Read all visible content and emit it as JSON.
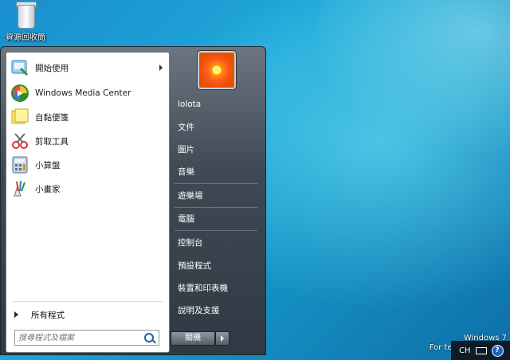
{
  "desktop": {
    "recycle_bin_label": "資源回收筒"
  },
  "start_menu": {
    "programs": [
      {
        "label": "開始使用",
        "icon": "getting-started-icon",
        "has_submenu": true
      },
      {
        "label": "Windows Media Center",
        "icon": "media-center-icon",
        "has_submenu": false
      },
      {
        "label": "自黏便箋",
        "icon": "sticky-notes-icon",
        "has_submenu": false
      },
      {
        "label": "剪取工具",
        "icon": "snipping-tool-icon",
        "has_submenu": false
      },
      {
        "label": "小算盤",
        "icon": "calculator-icon",
        "has_submenu": false
      },
      {
        "label": "小畫家",
        "icon": "paint-icon",
        "has_submenu": false
      }
    ],
    "all_programs_label": "所有程式",
    "search": {
      "placeholder": "搜尋程式及檔案",
      "value": ""
    },
    "user": {
      "name": "lolota",
      "avatar_icon": "flower-avatar-icon"
    },
    "right_items": [
      {
        "label": "文件"
      },
      {
        "label": "圖片"
      },
      {
        "label": "音樂"
      },
      {
        "label": "遊樂場"
      },
      {
        "label": "電腦"
      },
      {
        "label": "控制台"
      },
      {
        "label": "預設程式"
      },
      {
        "label": "裝置和印表機"
      },
      {
        "label": "說明及支援"
      }
    ],
    "shutdown_label": "關機"
  },
  "watermark": {
    "line1": "Windows 7",
    "line2": "For testing purpose"
  },
  "tray": {
    "language": "CH",
    "help_icon": "?"
  }
}
